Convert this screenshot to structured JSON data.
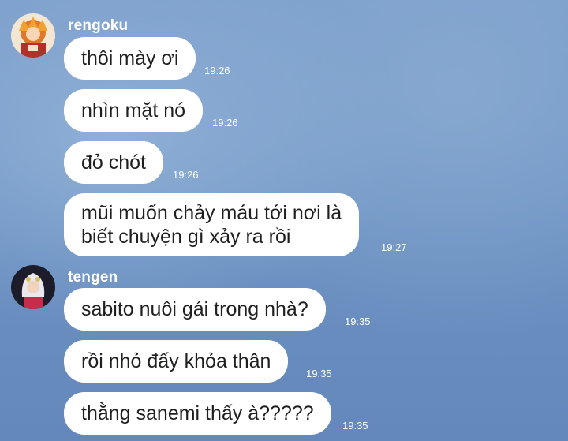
{
  "groups": [
    {
      "sender": "rengoku",
      "avatar_icon": "rengoku-avatar-icon",
      "messages": [
        {
          "text": "thôi mày ơi",
          "time": "19:26"
        },
        {
          "text": "nhìn mặt nó",
          "time": "19:26"
        },
        {
          "text": "đỏ chót",
          "time": "19:26"
        },
        {
          "lines": [
            "mũi muốn chảy máu tới nơi là",
            "biết chuyện gì xảy ra rồi"
          ],
          "time": "19:27"
        }
      ]
    },
    {
      "sender": "tengen",
      "avatar_icon": "tengen-avatar-icon",
      "messages": [
        {
          "text": "sabito nuôi gái trong nhà?",
          "time": "19:35"
        },
        {
          "text": "rồi nhỏ đấy khỏa thân",
          "time": "19:35"
        },
        {
          "text": "thằng sanemi thấy à?????",
          "time": "19:35"
        }
      ]
    }
  ],
  "colors": {
    "background": "#6a8fc0",
    "bubble": "#ffffff",
    "text": "#1f1f1f",
    "meta": "#ffffff"
  }
}
